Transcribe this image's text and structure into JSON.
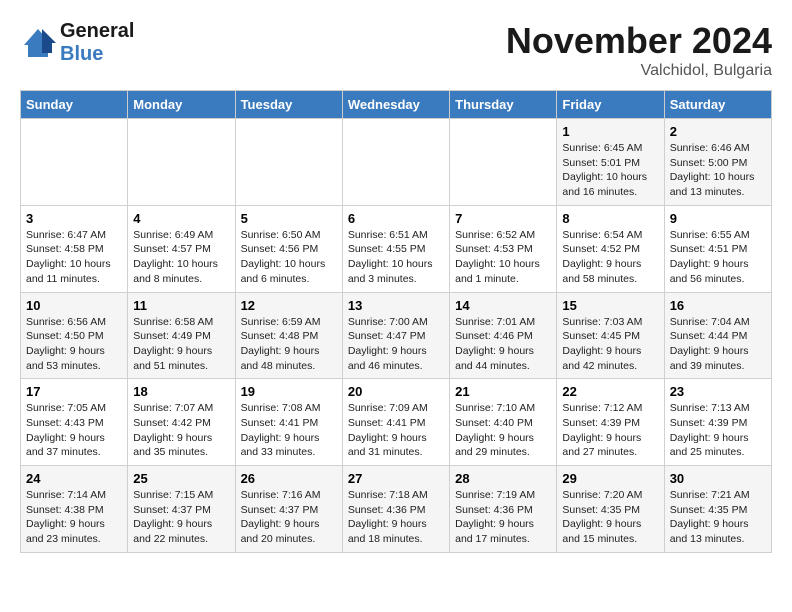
{
  "logo": {
    "line1": "General",
    "line2": "Blue"
  },
  "title": "November 2024",
  "location": "Valchidol, Bulgaria",
  "days_of_week": [
    "Sunday",
    "Monday",
    "Tuesday",
    "Wednesday",
    "Thursday",
    "Friday",
    "Saturday"
  ],
  "weeks": [
    [
      {
        "day": "",
        "info": ""
      },
      {
        "day": "",
        "info": ""
      },
      {
        "day": "",
        "info": ""
      },
      {
        "day": "",
        "info": ""
      },
      {
        "day": "",
        "info": ""
      },
      {
        "day": "1",
        "info": "Sunrise: 6:45 AM\nSunset: 5:01 PM\nDaylight: 10 hours\nand 16 minutes."
      },
      {
        "day": "2",
        "info": "Sunrise: 6:46 AM\nSunset: 5:00 PM\nDaylight: 10 hours\nand 13 minutes."
      }
    ],
    [
      {
        "day": "3",
        "info": "Sunrise: 6:47 AM\nSunset: 4:58 PM\nDaylight: 10 hours\nand 11 minutes."
      },
      {
        "day": "4",
        "info": "Sunrise: 6:49 AM\nSunset: 4:57 PM\nDaylight: 10 hours\nand 8 minutes."
      },
      {
        "day": "5",
        "info": "Sunrise: 6:50 AM\nSunset: 4:56 PM\nDaylight: 10 hours\nand 6 minutes."
      },
      {
        "day": "6",
        "info": "Sunrise: 6:51 AM\nSunset: 4:55 PM\nDaylight: 10 hours\nand 3 minutes."
      },
      {
        "day": "7",
        "info": "Sunrise: 6:52 AM\nSunset: 4:53 PM\nDaylight: 10 hours\nand 1 minute."
      },
      {
        "day": "8",
        "info": "Sunrise: 6:54 AM\nSunset: 4:52 PM\nDaylight: 9 hours\nand 58 minutes."
      },
      {
        "day": "9",
        "info": "Sunrise: 6:55 AM\nSunset: 4:51 PM\nDaylight: 9 hours\nand 56 minutes."
      }
    ],
    [
      {
        "day": "10",
        "info": "Sunrise: 6:56 AM\nSunset: 4:50 PM\nDaylight: 9 hours\nand 53 minutes."
      },
      {
        "day": "11",
        "info": "Sunrise: 6:58 AM\nSunset: 4:49 PM\nDaylight: 9 hours\nand 51 minutes."
      },
      {
        "day": "12",
        "info": "Sunrise: 6:59 AM\nSunset: 4:48 PM\nDaylight: 9 hours\nand 48 minutes."
      },
      {
        "day": "13",
        "info": "Sunrise: 7:00 AM\nSunset: 4:47 PM\nDaylight: 9 hours\nand 46 minutes."
      },
      {
        "day": "14",
        "info": "Sunrise: 7:01 AM\nSunset: 4:46 PM\nDaylight: 9 hours\nand 44 minutes."
      },
      {
        "day": "15",
        "info": "Sunrise: 7:03 AM\nSunset: 4:45 PM\nDaylight: 9 hours\nand 42 minutes."
      },
      {
        "day": "16",
        "info": "Sunrise: 7:04 AM\nSunset: 4:44 PM\nDaylight: 9 hours\nand 39 minutes."
      }
    ],
    [
      {
        "day": "17",
        "info": "Sunrise: 7:05 AM\nSunset: 4:43 PM\nDaylight: 9 hours\nand 37 minutes."
      },
      {
        "day": "18",
        "info": "Sunrise: 7:07 AM\nSunset: 4:42 PM\nDaylight: 9 hours\nand 35 minutes."
      },
      {
        "day": "19",
        "info": "Sunrise: 7:08 AM\nSunset: 4:41 PM\nDaylight: 9 hours\nand 33 minutes."
      },
      {
        "day": "20",
        "info": "Sunrise: 7:09 AM\nSunset: 4:41 PM\nDaylight: 9 hours\nand 31 minutes."
      },
      {
        "day": "21",
        "info": "Sunrise: 7:10 AM\nSunset: 4:40 PM\nDaylight: 9 hours\nand 29 minutes."
      },
      {
        "day": "22",
        "info": "Sunrise: 7:12 AM\nSunset: 4:39 PM\nDaylight: 9 hours\nand 27 minutes."
      },
      {
        "day": "23",
        "info": "Sunrise: 7:13 AM\nSunset: 4:39 PM\nDaylight: 9 hours\nand 25 minutes."
      }
    ],
    [
      {
        "day": "24",
        "info": "Sunrise: 7:14 AM\nSunset: 4:38 PM\nDaylight: 9 hours\nand 23 minutes."
      },
      {
        "day": "25",
        "info": "Sunrise: 7:15 AM\nSunset: 4:37 PM\nDaylight: 9 hours\nand 22 minutes."
      },
      {
        "day": "26",
        "info": "Sunrise: 7:16 AM\nSunset: 4:37 PM\nDaylight: 9 hours\nand 20 minutes."
      },
      {
        "day": "27",
        "info": "Sunrise: 7:18 AM\nSunset: 4:36 PM\nDaylight: 9 hours\nand 18 minutes."
      },
      {
        "day": "28",
        "info": "Sunrise: 7:19 AM\nSunset: 4:36 PM\nDaylight: 9 hours\nand 17 minutes."
      },
      {
        "day": "29",
        "info": "Sunrise: 7:20 AM\nSunset: 4:35 PM\nDaylight: 9 hours\nand 15 minutes."
      },
      {
        "day": "30",
        "info": "Sunrise: 7:21 AM\nSunset: 4:35 PM\nDaylight: 9 hours\nand 13 minutes."
      }
    ]
  ]
}
